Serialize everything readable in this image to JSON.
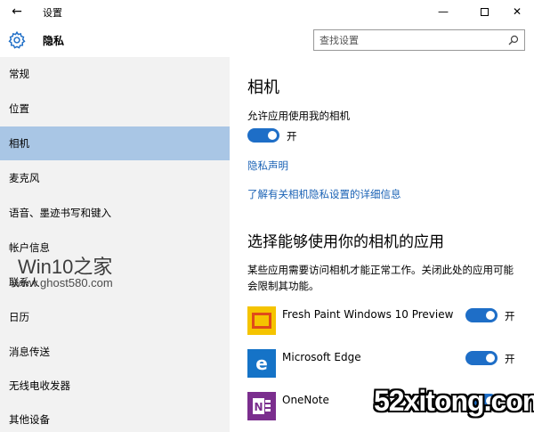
{
  "window": {
    "title": "设置",
    "back_glyph": "←",
    "minimize_glyph": "—",
    "close_glyph": "✕"
  },
  "header": {
    "title": "隐私",
    "icon": "gear-icon"
  },
  "search": {
    "placeholder": "查找设置",
    "icon": "search-icon"
  },
  "sidebar": {
    "items": [
      {
        "label": "常规",
        "selected": false
      },
      {
        "label": "位置",
        "selected": false
      },
      {
        "label": "相机",
        "selected": true
      },
      {
        "label": "麦克风",
        "selected": false
      },
      {
        "label": "语音、墨迹书写和键入",
        "selected": false
      },
      {
        "label": "帐户信息",
        "selected": false
      },
      {
        "label": "联系人",
        "selected": false
      },
      {
        "label": "日历",
        "selected": false
      },
      {
        "label": "消息传送",
        "selected": false
      },
      {
        "label": "无线电收发器",
        "selected": false
      },
      {
        "label": "其他设备",
        "selected": false
      }
    ]
  },
  "main": {
    "heading": "相机",
    "allow_label": "允许应用使用我的相机",
    "allow_toggle": {
      "on": true,
      "state_label": "开"
    },
    "privacy_link": "隐私声明",
    "learn_more_link": "了解有关相机隐私设置的详细信息",
    "apps_heading": "选择能够使用你的相机的应用",
    "apps_description": "某些应用需要访问相机才能正常工作。关闭此处的应用可能会限制其功能。",
    "apps": [
      {
        "name": "Fresh Paint Windows 10 Preview",
        "icon": "fresh-paint-icon",
        "on": true,
        "state_label": "开"
      },
      {
        "name": "Microsoft Edge",
        "icon": "edge-icon",
        "on": true,
        "state_label": "开"
      },
      {
        "name": "OneNote",
        "icon": "onenote-icon",
        "on": true,
        "state_label": ""
      }
    ]
  },
  "watermarks": {
    "top": "Win10之家",
    "top_url": "www.ghost580.com",
    "bottom": "52xitong.com"
  },
  "colors": {
    "accent": "#1e6ec7",
    "selected_nav": "#a9c6e5",
    "sidebar_bg": "#f2f2f2",
    "link": "#1a62b5"
  }
}
